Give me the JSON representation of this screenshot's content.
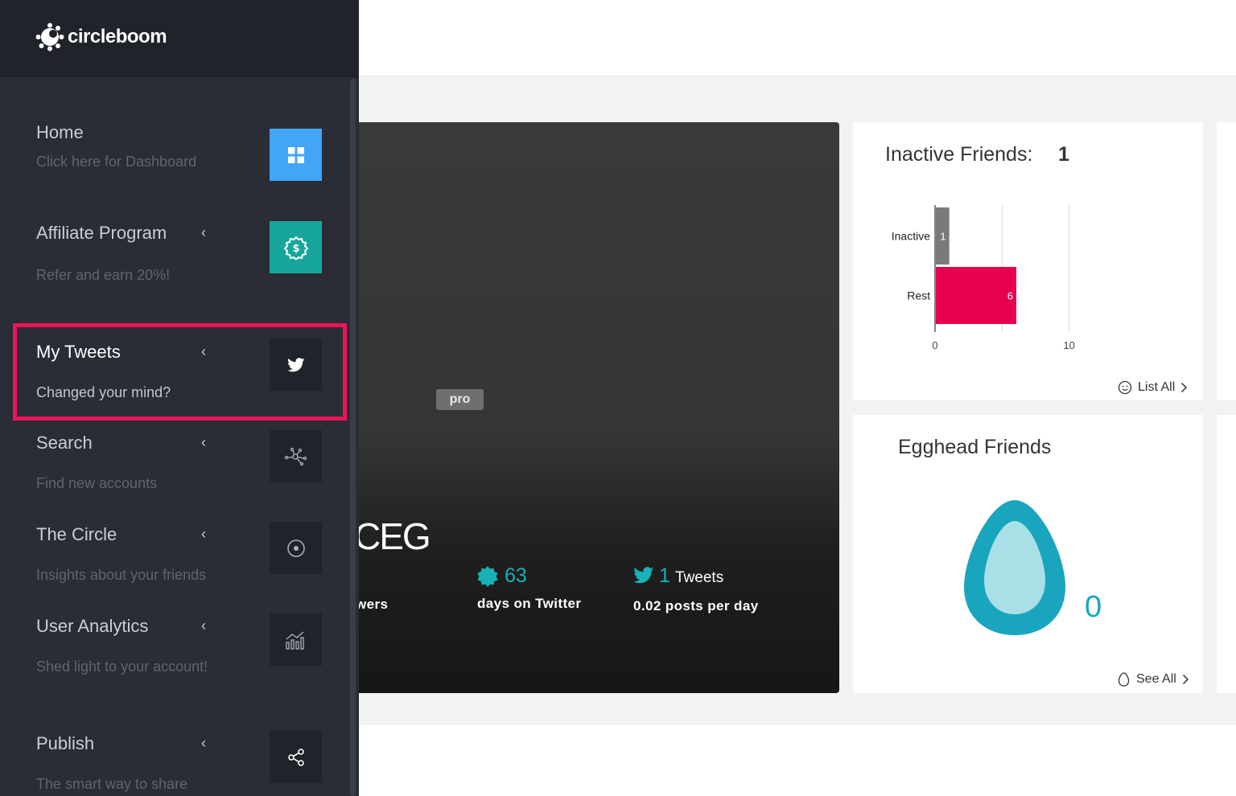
{
  "brand": {
    "name": "circleboom"
  },
  "sidebar": {
    "items": [
      {
        "title": "Home",
        "subtitle": "Click here for Dashboard",
        "icon": "grid-icon",
        "has_chevron": false
      },
      {
        "title": "Affiliate Program",
        "subtitle": "Refer and earn 20%!",
        "icon": "dollar-badge-icon",
        "has_chevron": true
      },
      {
        "title": "My Tweets",
        "subtitle": "Changed your mind?",
        "icon": "twitter-bird-icon",
        "has_chevron": true
      },
      {
        "title": "Search",
        "subtitle": "Find new accounts",
        "icon": "network-icon",
        "has_chevron": true
      },
      {
        "title": "The Circle",
        "subtitle": "Insights about your friends",
        "icon": "target-circle-icon",
        "has_chevron": true
      },
      {
        "title": "User Analytics",
        "subtitle": "Shed light to your account!",
        "icon": "analytics-chart-icon",
        "has_chevron": true
      },
      {
        "title": "Publish",
        "subtitle": "The smart way to share",
        "icon": "share-icon",
        "has_chevron": true
      }
    ],
    "chevron": "‹"
  },
  "profile": {
    "name_partial": "CEG",
    "badge": "pro",
    "stats": [
      {
        "number": "",
        "unit": "",
        "label": "wers"
      },
      {
        "number": "63",
        "unit": "",
        "label": "days on Twitter",
        "icon": "badge-icon"
      },
      {
        "number": "1",
        "unit": "Tweets",
        "label": "0.02 posts per day",
        "icon": "twitter-bird-icon"
      }
    ]
  },
  "inactive_card": {
    "title": "Inactive Friends:",
    "count": "1",
    "link": "List All",
    "chart_data": {
      "type": "bar",
      "orientation": "horizontal",
      "categories": [
        "Inactive",
        "Rest"
      ],
      "values": [
        1,
        6
      ],
      "colors": [
        "#7a7a7a",
        "#e8004f"
      ],
      "xlim": [
        0,
        12
      ],
      "x_ticks": [
        0,
        10
      ]
    }
  },
  "egghead_card": {
    "title": "Egghead Friends",
    "count": "0",
    "link": "See All"
  },
  "colors": {
    "accent_pink": "#ee1458",
    "teal": "#17b2b6",
    "home_blue": "#42a5f5",
    "affiliate_green": "#16a79a"
  }
}
